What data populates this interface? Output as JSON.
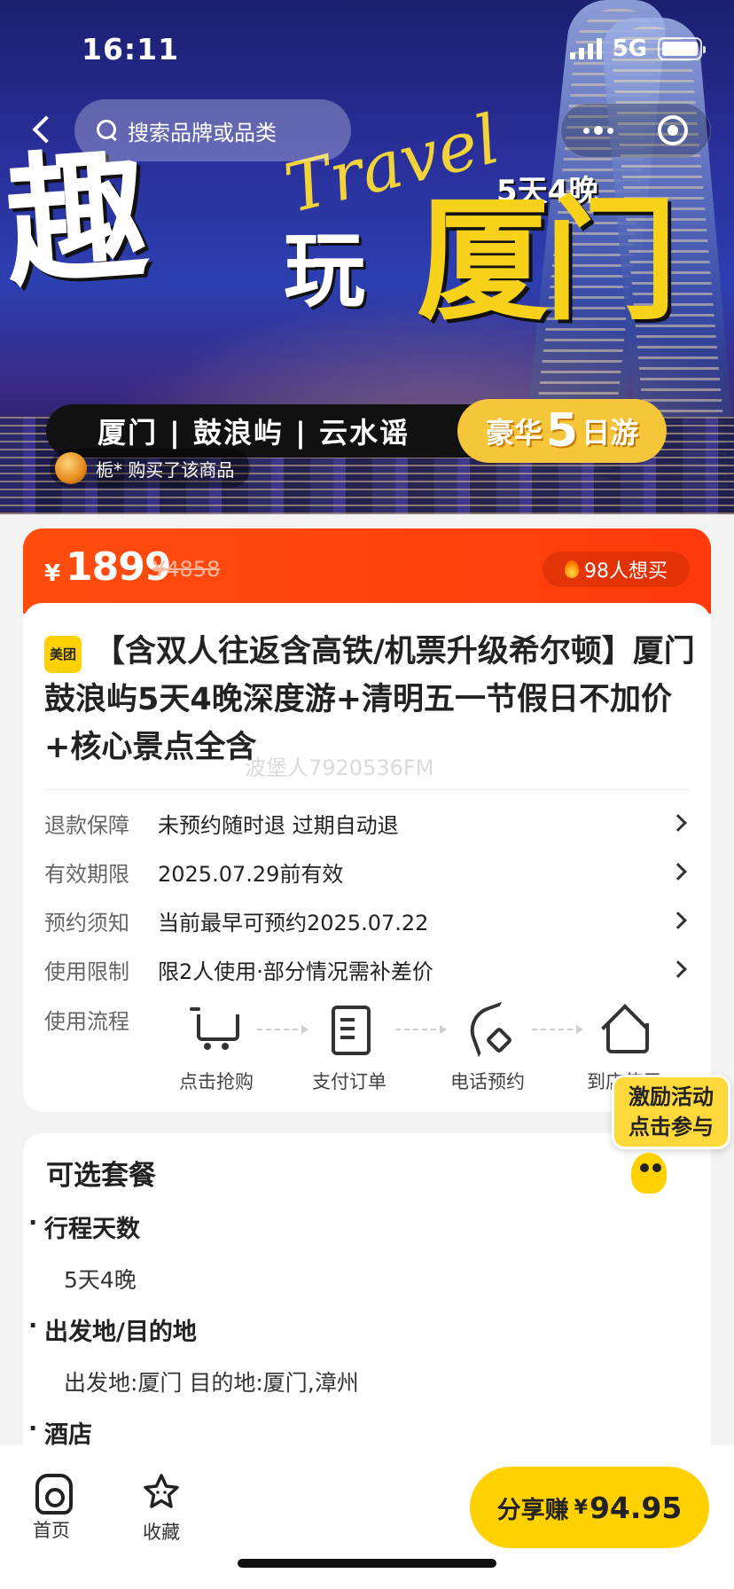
{
  "status_bar": {
    "time": "16:11",
    "network": "5G"
  },
  "nav": {
    "search_placeholder": "搜索品牌或品类"
  },
  "banner": {
    "title_a": "趣",
    "title_b": "玩",
    "title_c": "厦门",
    "script": "Travel",
    "nights": "5天4晚",
    "route": "厦门 | 鼓浪屿 | 云水谣",
    "badge_pre": "豪华",
    "badge_num": "5",
    "badge_post": "日游",
    "buyer_text": "栀* 购买了该商品"
  },
  "price": {
    "currency": "¥",
    "current": "1899",
    "original": "¥4858",
    "want": "98人想买"
  },
  "product": {
    "brand_logo": "美团",
    "title": "【含双人往返含高铁/机票升级希尔顿】厦门鼓浪屿5天4晚深度游+清明五一节假日不加价+核心景点全含",
    "watermark": "波堡人7920536FM"
  },
  "info_rows": [
    {
      "label": "退款保障",
      "value": "未预约随时退 过期自动退"
    },
    {
      "label": "有效期限",
      "value": "2025.07.29前有效"
    },
    {
      "label": "预约须知",
      "value": "当前最早可预约2025.07.22"
    },
    {
      "label": "使用限制",
      "value": "限2人使用·部分情况需补差价"
    }
  ],
  "flow": {
    "label": "使用流程",
    "steps": [
      {
        "icon": "cart-icon",
        "text": "点击抢购"
      },
      {
        "icon": "document-icon",
        "text": "支付订单"
      },
      {
        "icon": "phone-icon",
        "text": "电话预约"
      },
      {
        "icon": "home-icon",
        "text": "到店使用"
      }
    ]
  },
  "activity": {
    "line1": "激励活动",
    "line2": "点击参与"
  },
  "options": {
    "title": "可选套餐",
    "groups": [
      {
        "head": "行程天数",
        "value": "5天4晚"
      },
      {
        "head": "出发地/目的地",
        "value": "出发地:厦门 目的地:厦门,漳州"
      },
      {
        "head": "酒店",
        "value": ""
      }
    ]
  },
  "bottom": {
    "home": "首页",
    "favorite": "收藏",
    "share_label": "分享赚",
    "share_currency": "¥",
    "share_amount": "94.95"
  },
  "colors": {
    "accent_orange": "#ff4d0d",
    "brand_yellow": "#ffd100"
  }
}
